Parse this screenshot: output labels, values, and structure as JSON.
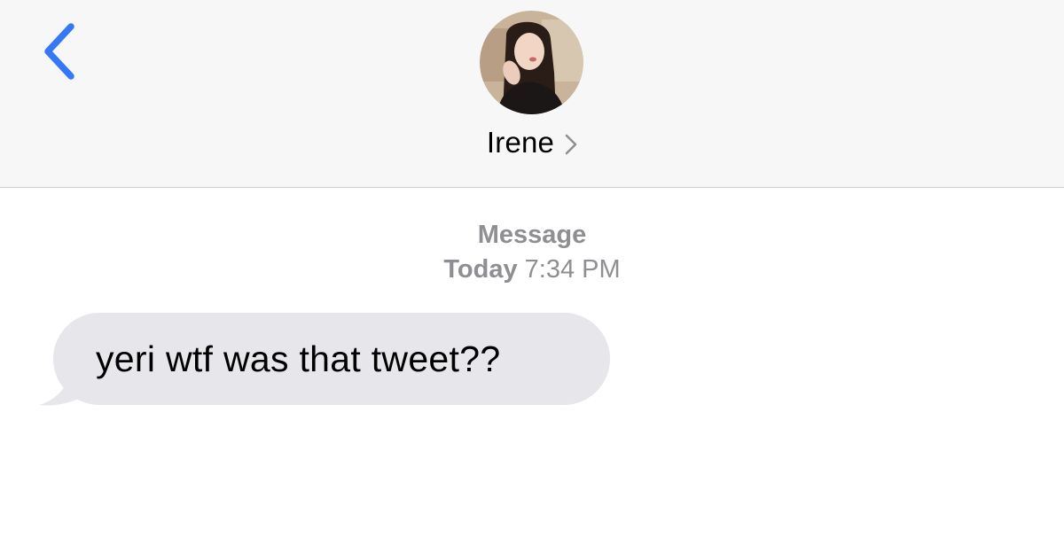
{
  "header": {
    "contact_name": "Irene",
    "back_icon": "chevron-left-icon",
    "accent_color": "#3478f6"
  },
  "conversation": {
    "service_label": "Message",
    "day_label": "Today",
    "time_label": "7:34 PM"
  },
  "messages": [
    {
      "direction": "incoming",
      "text": "yeri wtf was that tweet??",
      "bubble_color": "#e6e6eb"
    }
  ]
}
